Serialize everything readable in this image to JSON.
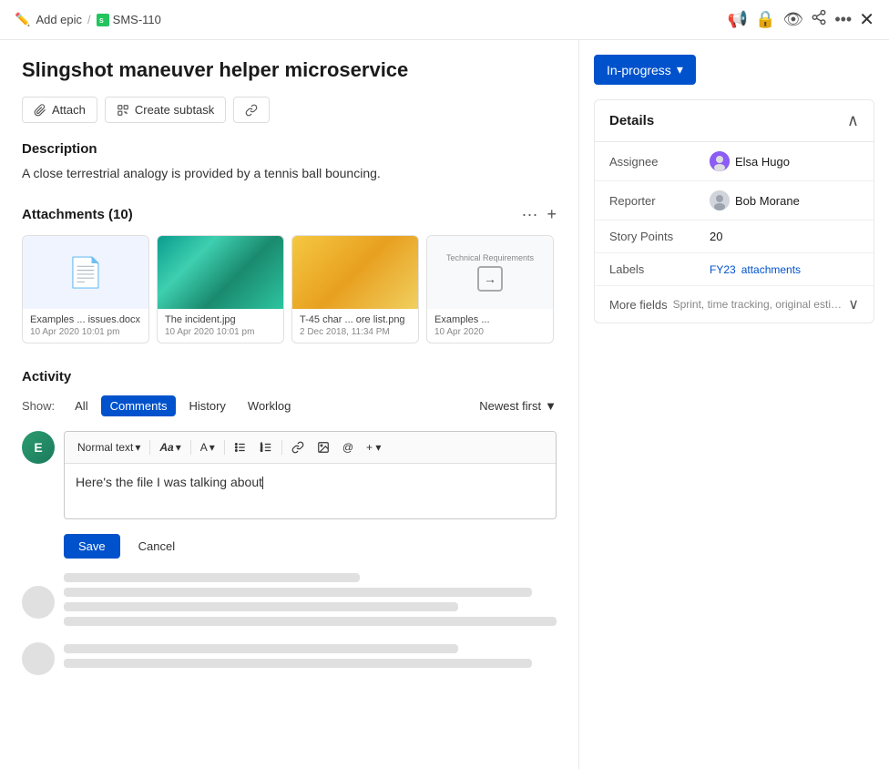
{
  "topbar": {
    "add_epic_label": "Add epic",
    "separator": "/",
    "ticket_id": "SMS-110",
    "icons": [
      "megaphone",
      "lock",
      "eye",
      "share",
      "more",
      "close"
    ]
  },
  "page": {
    "title": "Slingshot maneuver helper microservice"
  },
  "actions": {
    "attach_label": "Attach",
    "create_subtask_label": "Create subtask"
  },
  "description": {
    "label": "Description",
    "text": "A close terrestrial analogy is provided by a tennis ball bouncing."
  },
  "attachments": {
    "title": "Attachments",
    "count": "10",
    "files": [
      {
        "name": "Examples ... issues.docx",
        "date": "10 Apr 2020 10:01 pm",
        "type": "doc"
      },
      {
        "name": "The incident.jpg",
        "date": "10 Apr 2020 10:01 pm",
        "type": "ocean"
      },
      {
        "name": "T-45 char ... ore list.png",
        "date": "2 Dec 2018, 11:34 PM",
        "type": "yellow"
      },
      {
        "name": "Examples ...",
        "date": "10 Apr 202O",
        "type": "doc-arrow"
      }
    ]
  },
  "activity": {
    "title": "Activity",
    "show_label": "Show:",
    "filters": [
      "All",
      "Comments",
      "History",
      "Worklog"
    ],
    "active_filter": "Comments",
    "newest_label": "Newest first"
  },
  "comment_editor": {
    "text_style_label": "Normal text",
    "text_content": "Here's the file I was talking about",
    "save_label": "Save",
    "cancel_label": "Cancel"
  },
  "details": {
    "title": "Details",
    "assignee_label": "Assignee",
    "assignee_name": "Elsa Hugo",
    "reporter_label": "Reporter",
    "reporter_name": "Bob Morane",
    "story_points_label": "Story Points",
    "story_points_value": "20",
    "labels_label": "Labels",
    "label_1": "FY23",
    "label_2": "attachments",
    "more_fields_label": "More fields",
    "more_fields_preview": "Sprint, time tracking, original estimate ..."
  },
  "status": {
    "label": "In-progress"
  }
}
